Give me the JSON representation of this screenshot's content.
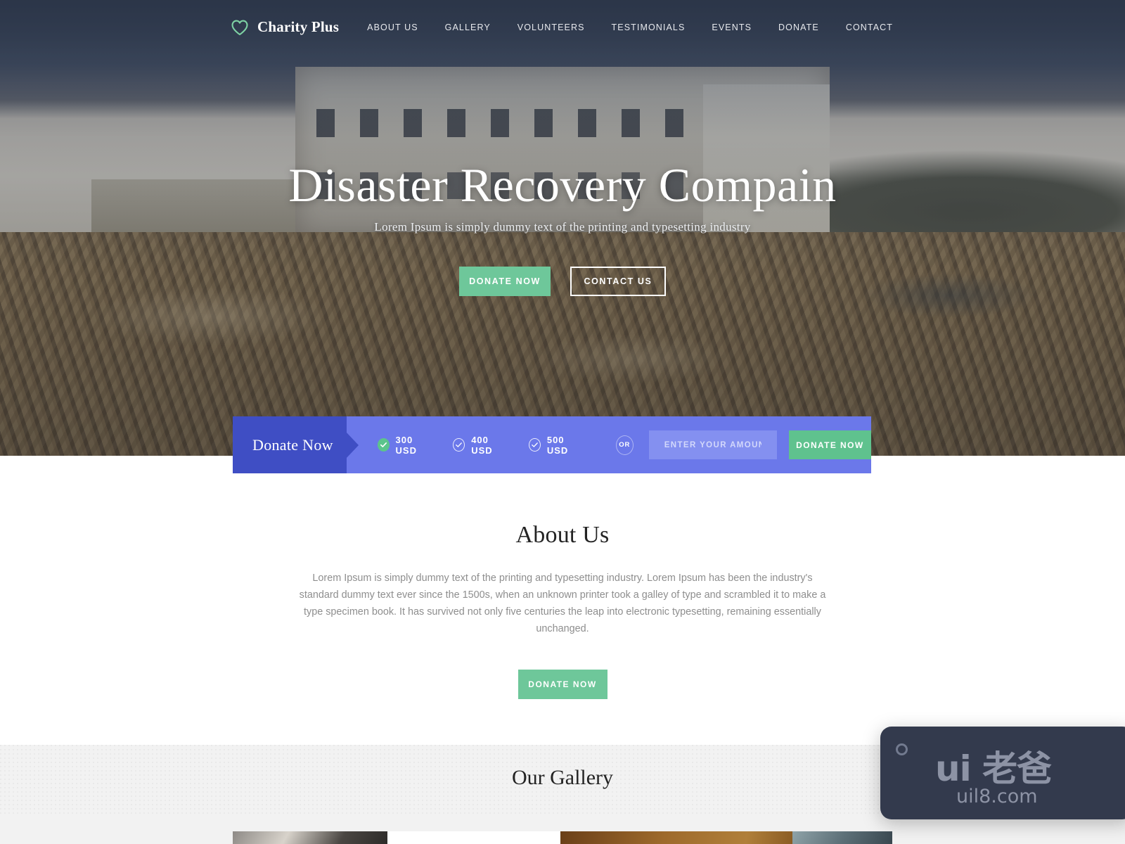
{
  "header": {
    "brand": "Charity Plus",
    "brand_icon": "heart-outline-icon",
    "nav": [
      {
        "label": "ABOUT US"
      },
      {
        "label": "GALLERY"
      },
      {
        "label": "VOLUNTEERS"
      },
      {
        "label": "TESTIMONIALS"
      },
      {
        "label": "EVENTS"
      },
      {
        "label": "DONATE"
      },
      {
        "label": "CONTACT"
      }
    ]
  },
  "hero": {
    "title": "Disaster Recovery Compain",
    "subtitle": "Lorem Ipsum is simply dummy text of the printing and typesetting industry",
    "primary_button": "DONATE NOW",
    "secondary_button": "CONTACT US"
  },
  "donate_bar": {
    "label": "Donate Now",
    "options": [
      {
        "label": "300 USD",
        "checked": true
      },
      {
        "label": "400 USD",
        "checked": false
      },
      {
        "label": "500 USD",
        "checked": false
      }
    ],
    "or_label": "OR",
    "amount_placeholder": "ENTER YOUR AMOUNT",
    "amount_value": "",
    "submit_label": "DONATE NOW"
  },
  "about": {
    "title": "About Us",
    "paragraph": "Lorem Ipsum is simply dummy text of the printing and typesetting industry. Lorem Ipsum has been the industry's standard dummy text ever since the 1500s, when an unknown printer took a galley of type and scrambled it to make a type specimen book. It has survived not only five centuries the leap into electronic typesetting, remaining essentially unchanged.",
    "button": "DONATE NOW"
  },
  "gallery": {
    "title": "Our Gallery"
  },
  "watermark": {
    "main": "ui 老爸",
    "sub": "uil8.com"
  },
  "colors": {
    "header_bg": "#2f3b4e",
    "accent_green": "#6ec79a",
    "donate_bar_bg": "#6b78ea",
    "donate_label_bg": "#3f4ec4",
    "gallery_bg": "#f2f2f2",
    "watermark_bg": "#333a4d"
  }
}
